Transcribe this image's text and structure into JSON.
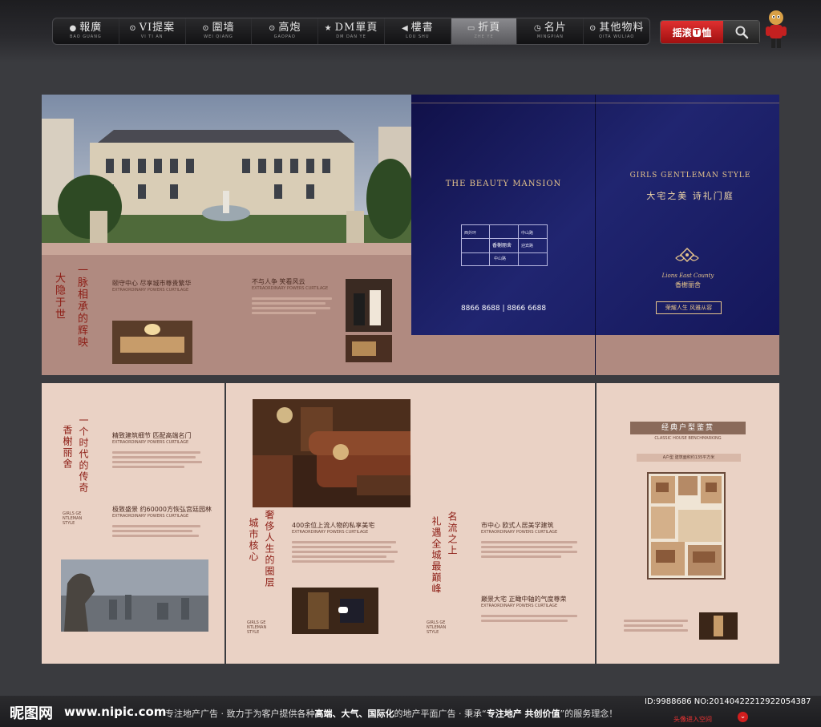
{
  "nav": {
    "items": [
      {
        "icon": "●",
        "label": "報廣",
        "sub": "BAO GUANG"
      },
      {
        "icon": "⊙",
        "label": "VI提案",
        "sub": "VI TI AN"
      },
      {
        "icon": "⊙",
        "label": "圍墙",
        "sub": "WEI QIANG"
      },
      {
        "icon": "⊙",
        "label": "高炮",
        "sub": "GAOPAO"
      },
      {
        "icon": "★",
        "label": "DM單頁",
        "sub": "DM DAN YE"
      },
      {
        "icon": "◀",
        "label": "樓書",
        "sub": "LOU SHU"
      },
      {
        "icon": "▭",
        "label": "折頁",
        "sub": "ZHE YE"
      },
      {
        "icon": "◷",
        "label": "名片",
        "sub": "MINGPIAN"
      },
      {
        "icon": "⊙",
        "label": "其他物料",
        "sub": "QITA WULIAO"
      }
    ]
  },
  "search": {
    "logo_pre": "摇滚",
    "logo_mid": "T",
    "logo_post": "恤"
  },
  "brochure": {
    "top": {
      "left": {
        "vert_a": "大隐于世",
        "vert_b": "一脉相承的辉映",
        "h1": "颐守中心 尽享城市尊贵繁华",
        "h1_sub": "EXTRAORDINARY POWERS CURTILAGE",
        "h2": "不与人争 笑看风云",
        "h2_sub": "EXTRAORDINARY POWERS CURTILAGE"
      },
      "cover": {
        "en_left": "THE BEAUTY MANSION",
        "map_labels": [
          "西外环",
          "香榭丽舍",
          "中山路",
          "迎宾路",
          "中山路"
        ],
        "phone": "8866 8688 | 8866 6688",
        "en_right": "GIRLS GENTLEMAN STYLE",
        "cn_right": "大宅之美 诗礼门庭",
        "logo_en": "Lions East County",
        "logo_cn": "香榭丽舍",
        "tag": "荣耀人生 风雅从容"
      }
    },
    "bottom": {
      "p1": {
        "vert_a": "香榭丽舍",
        "vert_b": "一个时代的传奇",
        "h1": "精致建筑细节 匹配高端名门",
        "h1_sub": "EXTRAORDINARY POWERS CURTILAGE",
        "h2": "极致盛景 约60000方恢弘宫廷园林",
        "h2_sub": "EXTRAORDINARY POWERS CURTILAGE",
        "foot": "GIRLS GE NTLEMAN STYLE"
      },
      "p2": {
        "vert_a": "城市核心",
        "vert_b": "奢侈人生的圈层",
        "h1": "400余位上流人物的私享美宅",
        "h1_sub": "EXTRAORDINARY POWERS CURTILAGE",
        "foot": "GIRLS GE NTLEMAN STYLE"
      },
      "p3": {
        "vert_a": "名流之上",
        "vert_b": "礼遇全城最巅峰",
        "h1": "市中心 欧式人居美学建筑",
        "h1_sub": "EXTRAORDINARY POWERS CURTILAGE",
        "h2": "巅景大宅 正瞰中轴的气度尊荣",
        "h2_sub": "EXTRAORDINARY POWERS CURTILAGE",
        "foot": "GIRLS GE NTLEMAN STYLE"
      },
      "p4": {
        "title": "经典户型鉴赏",
        "title_sub": "CLASSIC HOUSE BENCHMARKING",
        "plan_label": "A户型 建筑面积约135平方米"
      }
    }
  },
  "footer": {
    "site_logo": "昵图网",
    "site_url": "www.nipic.com",
    "slogan_a": "专注地产广告 · 致力于为客户提供各种",
    "slogan_b": "高端、大气、国际化",
    "slogan_c": "的地产平面广告 · 秉承“",
    "slogan_d": "专注地产 共创价值",
    "slogan_e": "”的服务理念！",
    "id_line": "ID:9988686 NO:20140422212922054387",
    "link": "头像进入空间"
  },
  "colors": {
    "accent_red": "#8c1c14",
    "navy": "#161a5a",
    "paper": "#ead2c5",
    "mauve": "#b08a80",
    "gold": "#c9a87a"
  }
}
